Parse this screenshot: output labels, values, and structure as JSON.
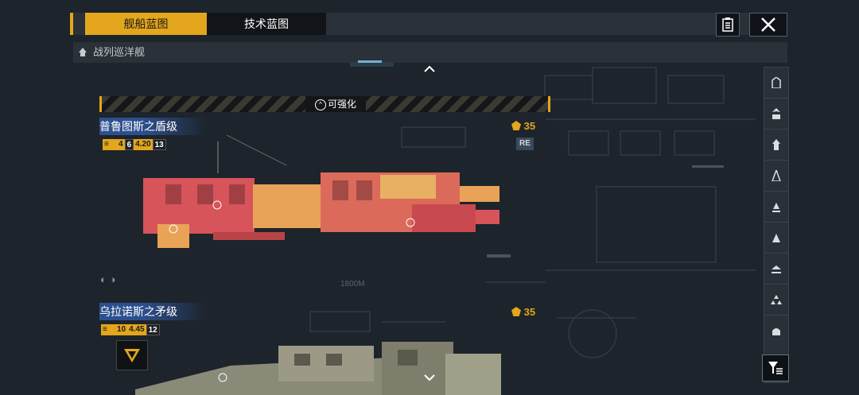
{
  "header": {
    "tabs": [
      {
        "label": "舰船蓝图",
        "active": true
      },
      {
        "label": "技术蓝图",
        "active": false
      }
    ],
    "notes_icon": "clipboard-icon",
    "close_icon": "close-icon"
  },
  "subheader": {
    "category": "战列巡洋舰"
  },
  "upgrade_banner": {
    "label": "可强化"
  },
  "ships": [
    {
      "name": "普鲁图斯之盾级",
      "cost": "35",
      "stats": [
        "4",
        "6",
        "4.20",
        "13"
      ],
      "tag": "RE",
      "distance_label": "1800M"
    },
    {
      "name": "乌拉诺斯之矛级",
      "cost": "35",
      "stats": [
        "10",
        "4.45",
        "12"
      ]
    }
  ],
  "filter_rail": {
    "items": [
      "hull-icon",
      "carrier-icon",
      "cruiser-icon",
      "destroyer-icon",
      "frigate-icon",
      "corvette-icon",
      "aux-icon",
      "fighter-icon",
      "station-icon"
    ],
    "filter_icon": "filter-icon"
  },
  "colors": {
    "accent": "#e3a61c",
    "name_bar": "#2c4f8e",
    "background": "#1d242b"
  }
}
